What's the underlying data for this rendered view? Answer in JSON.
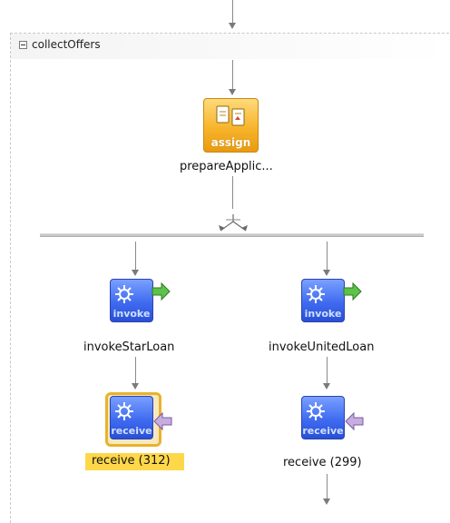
{
  "scope": {
    "title": "collectOffers",
    "collapse_icon": "minus-box-icon"
  },
  "activities": {
    "assign": {
      "label": "prepareApplic...",
      "icon_text": "assign",
      "color": "#f7b52c"
    },
    "invoke_star": {
      "label": "invokeStarLoan",
      "icon_text": "invoke",
      "color": "#3f6bf0"
    },
    "invoke_united": {
      "label": "invokeUnitedLoan",
      "icon_text": "invoke",
      "color": "#3f6bf0"
    },
    "receive_star": {
      "label": "receive (312)",
      "icon_text": "receive",
      "selected": true,
      "highlight_color": "#ffd84a"
    },
    "receive_united": {
      "label": "receive (299)",
      "icon_text": "receive"
    }
  },
  "icons": {
    "gear": "gear-icon",
    "arrow_out": "green-arrow-icon",
    "arrow_in": "purple-arrow-icon",
    "documents": "documents-icon",
    "flow_split": "flow-split-icon"
  },
  "colors": {
    "connector": "#8a8a8a",
    "flow_bar": "#c8c8c8",
    "invoke_arrow": "#5cc24a",
    "receive_arrow": "#b89ad8"
  }
}
